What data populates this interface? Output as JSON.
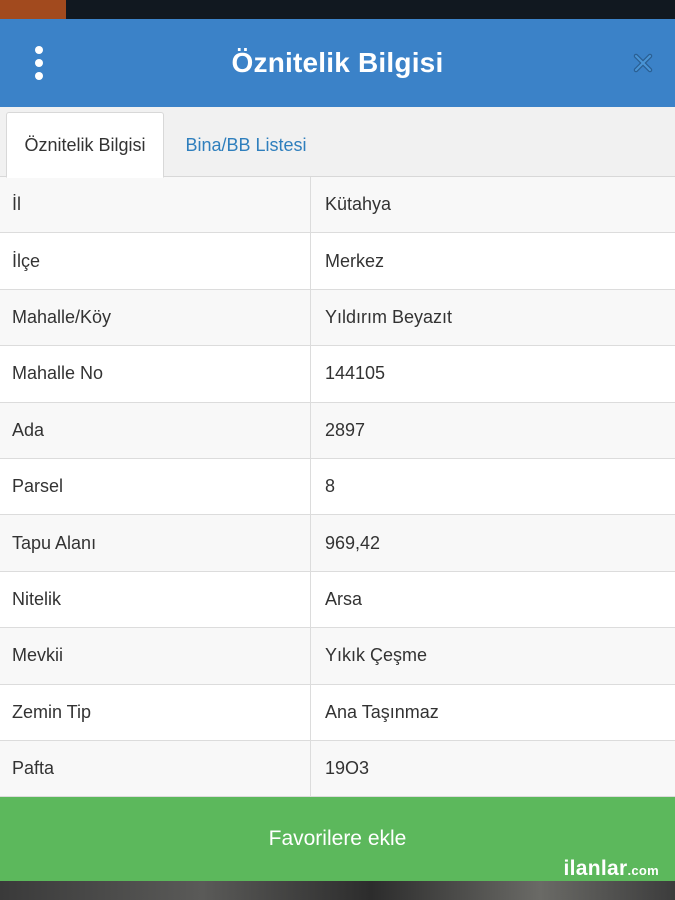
{
  "header": {
    "title": "Öznitelik Bilgisi",
    "menu_icon": "more-vertical-icon",
    "close_icon": "close-icon",
    "color": "#3b82c8"
  },
  "tabs": [
    {
      "label": "Öznitelik Bilgisi",
      "active": true
    },
    {
      "label": "Bina/BB Listesi",
      "active": false
    }
  ],
  "attributes": [
    {
      "key": "İl",
      "value": "Kütahya"
    },
    {
      "key": "İlçe",
      "value": "Merkez"
    },
    {
      "key": "Mahalle/Köy",
      "value": "Yıldırım Beyazıt"
    },
    {
      "key": "Mahalle No",
      "value": "144105"
    },
    {
      "key": "Ada",
      "value": "2897"
    },
    {
      "key": "Parsel",
      "value": "8"
    },
    {
      "key": "Tapu Alanı",
      "value": "969,42"
    },
    {
      "key": "Nitelik",
      "value": "Arsa"
    },
    {
      "key": "Mevkii",
      "value": "Yıkık Çeşme"
    },
    {
      "key": "Zemin Tip",
      "value": "Ana Taşınmaz"
    },
    {
      "key": "Pafta",
      "value": "19O3"
    }
  ],
  "footer": {
    "favorite_label": "Favorilere ekle",
    "color": "#5cb85c"
  },
  "watermark": {
    "brand": "ilanlar",
    "suffix": ".com"
  }
}
